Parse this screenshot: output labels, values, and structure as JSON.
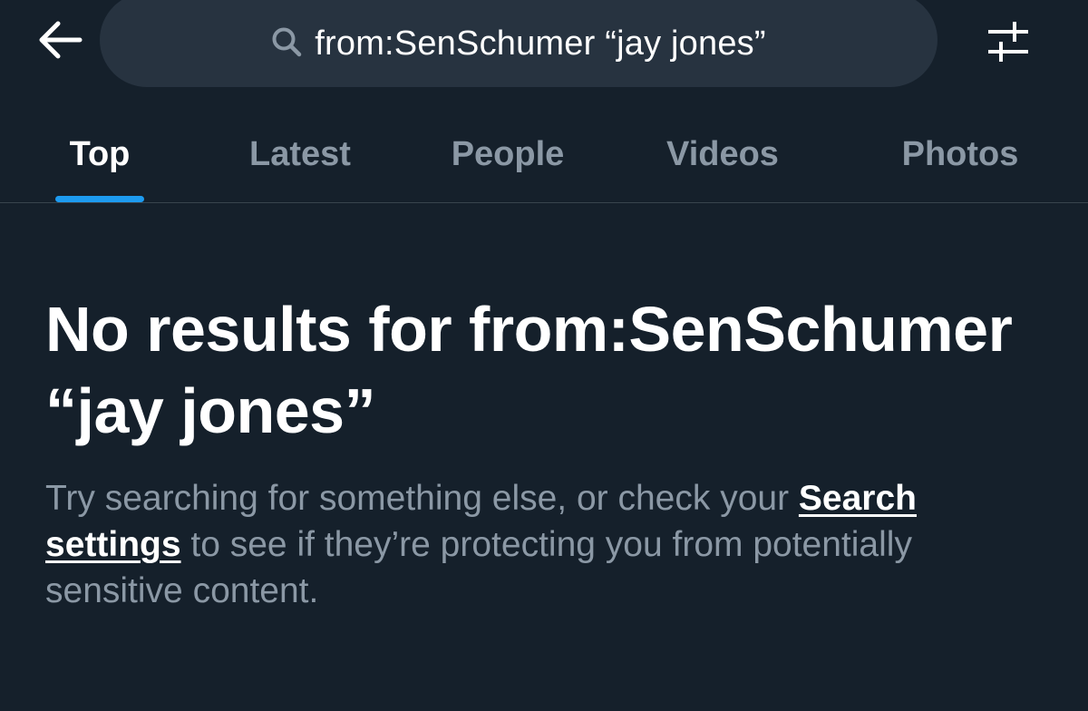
{
  "header": {
    "back_icon": "arrow-left-icon",
    "search_icon": "search-icon",
    "search_query": "from:SenSchumer “jay jones”",
    "filter_icon": "sliders-icon"
  },
  "tabs": [
    {
      "label": "Top",
      "active": true
    },
    {
      "label": "Latest",
      "active": false
    },
    {
      "label": "People",
      "active": false
    },
    {
      "label": "Videos",
      "active": false
    },
    {
      "label": "Photos",
      "active": false
    }
  ],
  "empty_state": {
    "title": "No results for from:SenSchumer “jay jones”",
    "body_before": "Try searching for something else, or check your ",
    "link_label": "Search settings",
    "body_after": " to see if they’re protecting you from potentially sensitive content."
  },
  "colors": {
    "background": "#15202b",
    "search_bg": "#273340",
    "accent": "#1d9bf0",
    "muted_text": "#8b98a5"
  }
}
